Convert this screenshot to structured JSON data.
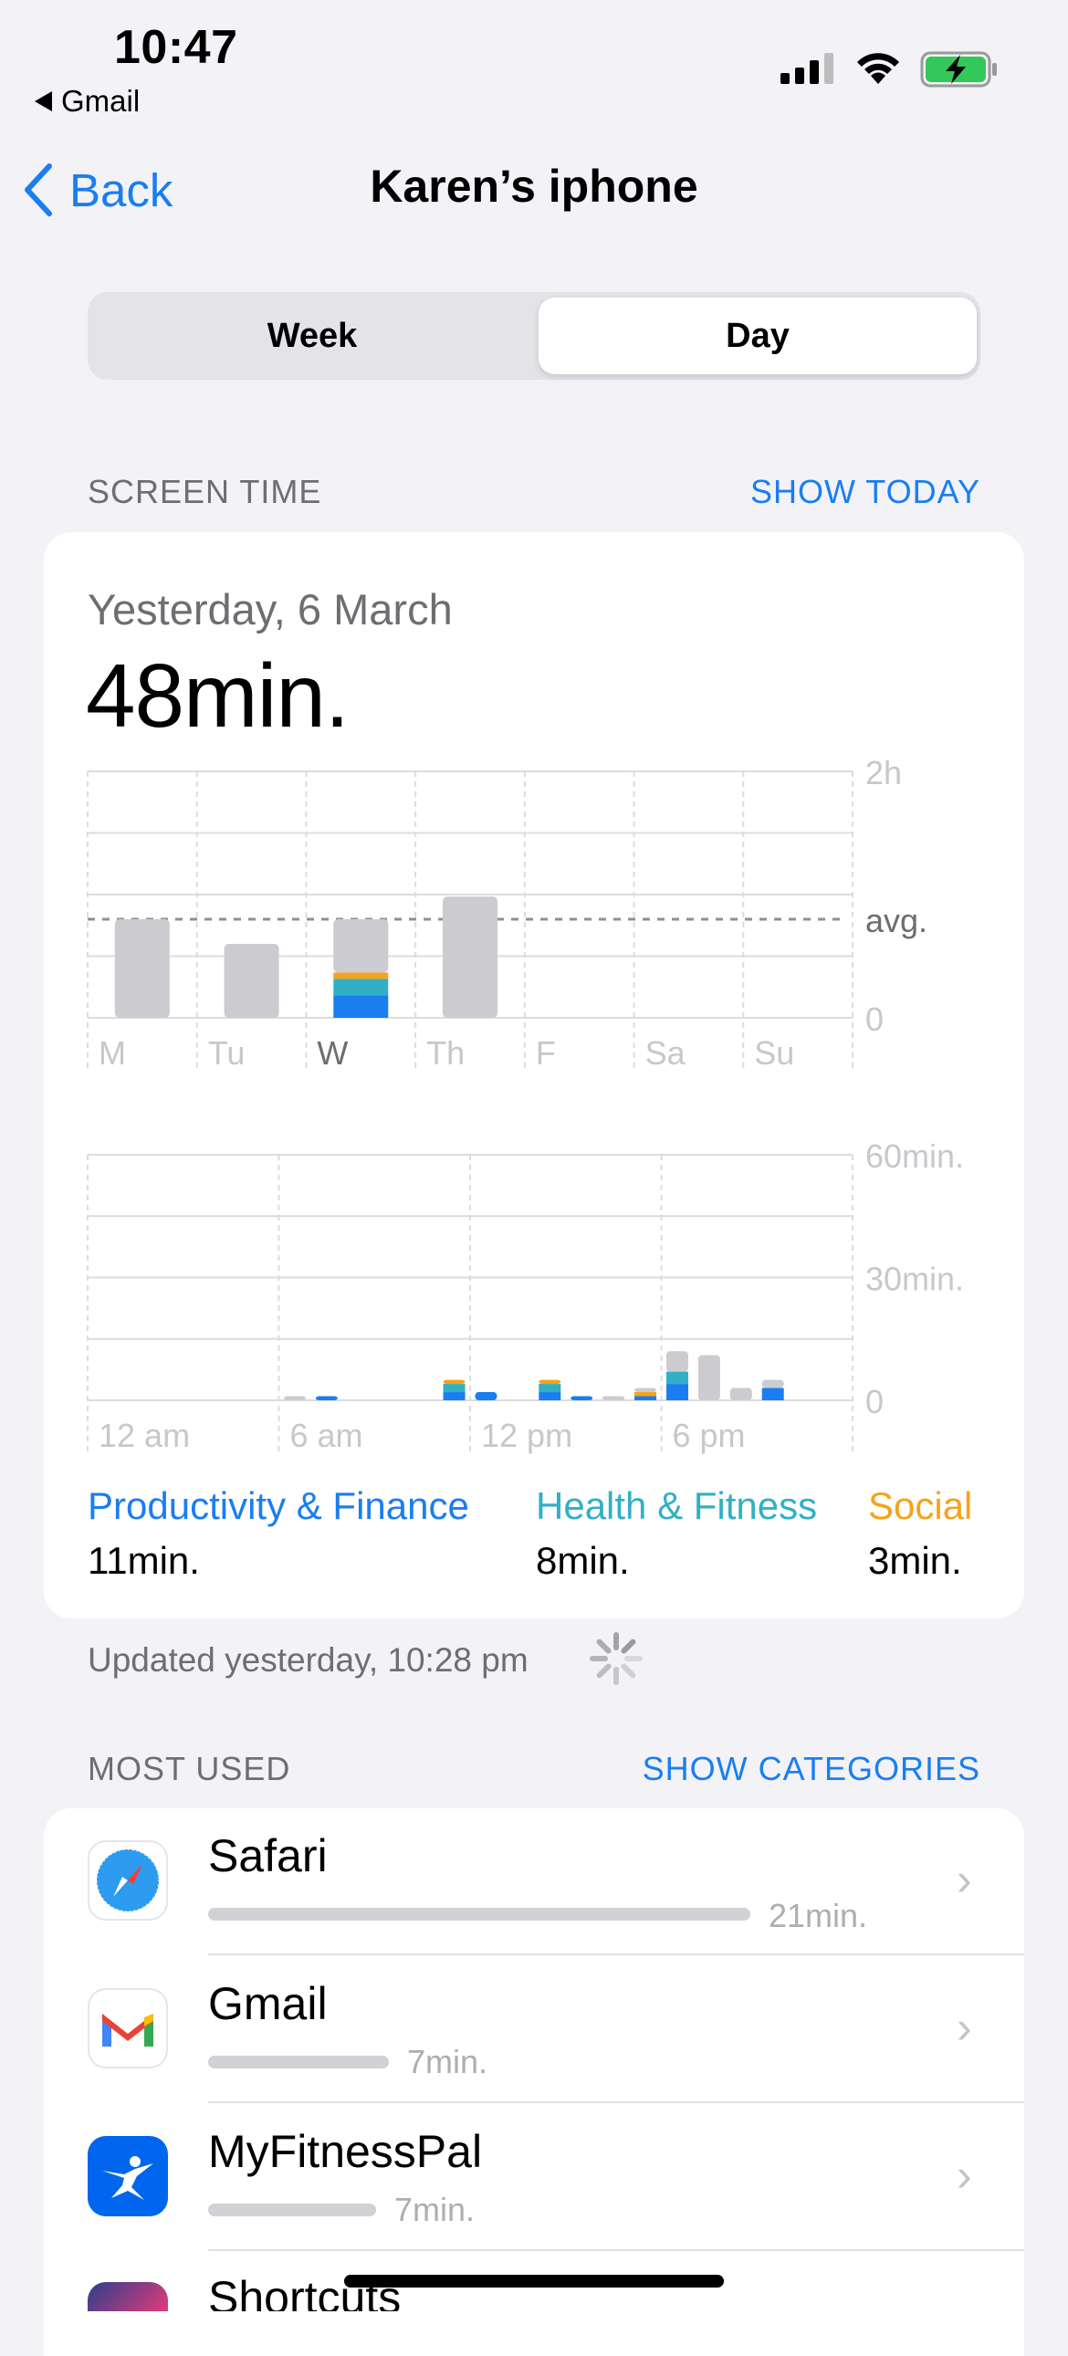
{
  "status_bar": {
    "time": "10:47",
    "back_app": "Gmail"
  },
  "nav": {
    "back_label": "Back",
    "title": "Karen’s iphone"
  },
  "segment": {
    "week": "Week",
    "day": "Day",
    "selected": "Day"
  },
  "screen_time": {
    "header": "SCREEN TIME",
    "action": "SHOW TODAY",
    "date": "Yesterday, 6 March",
    "total": "48min.",
    "updated": "Updated yesterday, 10:28 pm"
  },
  "colors": {
    "accent": "#1A7EF0",
    "productivity": "#1A7EF0",
    "health": "#31B0C5",
    "social": "#F7A21B",
    "other": "#CCCCD0"
  },
  "chart_data": [
    {
      "type": "bar",
      "categories": [
        "M",
        "Tu",
        "W",
        "Th",
        "F",
        "Sa",
        "Su"
      ],
      "ylim": [
        0,
        120
      ],
      "y_ticks": [
        "2h",
        "avg.",
        "0"
      ],
      "average": 48,
      "series": [
        {
          "name": "Productivity & Finance",
          "values": [
            0,
            0,
            11,
            0,
            0,
            0,
            0
          ]
        },
        {
          "name": "Health & Fitness",
          "values": [
            0,
            0,
            8,
            0,
            0,
            0,
            0
          ]
        },
        {
          "name": "Social",
          "values": [
            0,
            0,
            3,
            0,
            0,
            0,
            0
          ]
        },
        {
          "name": "",
          "values": [
            48,
            36,
            26,
            59,
            0,
            0,
            0
          ]
        }
      ]
    },
    {
      "type": "bar",
      "categories": [
        "0",
        "1",
        "2",
        "3",
        "4",
        "5",
        "6",
        "7",
        "8",
        "9",
        "10",
        "11",
        "12",
        "13",
        "14",
        "15",
        "16",
        "17",
        "18",
        "19",
        "20",
        "21",
        "22",
        "23"
      ],
      "x_tick_labels": [
        "12 am",
        "6 am",
        "12 pm",
        "6 pm"
      ],
      "y_ticks": [
        "60min.",
        "30min.",
        "0"
      ],
      "ylim": [
        0,
        60
      ],
      "series": [
        {
          "name": "Productivity & Finance",
          "values": [
            0,
            0,
            0,
            0,
            0,
            0,
            0,
            1,
            0,
            0,
            0,
            2,
            2,
            0,
            2,
            1,
            0,
            1,
            4,
            0,
            0,
            3,
            0,
            0
          ]
        },
        {
          "name": "Health & Fitness",
          "values": [
            0,
            0,
            0,
            0,
            0,
            0,
            0,
            0,
            0,
            0,
            0,
            2,
            0,
            0,
            2,
            0,
            0,
            0,
            3,
            0,
            0,
            0,
            0,
            0
          ]
        },
        {
          "name": "Social",
          "values": [
            0,
            0,
            0,
            0,
            0,
            0,
            0,
            0,
            0,
            0,
            0,
            1,
            0,
            0,
            1,
            0,
            0,
            1,
            0,
            0,
            0,
            0,
            0,
            0
          ]
        },
        {
          "name": "",
          "values": [
            0,
            0,
            0,
            0,
            0,
            0,
            1,
            0,
            0,
            0,
            0,
            0,
            0,
            0,
            0,
            0,
            1,
            1,
            5,
            11,
            3,
            2,
            0,
            0
          ]
        }
      ]
    }
  ],
  "categories": [
    {
      "name": "Productivity & Finance",
      "time": "11min."
    },
    {
      "name": "Health & Fitness",
      "time": "8min."
    },
    {
      "name": "Social",
      "time": "3min."
    }
  ],
  "most_used": {
    "header": "MOST USED",
    "action": "SHOW CATEGORIES",
    "apps": [
      {
        "name": "Safari",
        "time": "21min.",
        "minutes": 21
      },
      {
        "name": "Gmail",
        "time": "7min.",
        "minutes": 7
      },
      {
        "name": "MyFitnessPal",
        "time": "7min.",
        "minutes": 6.5
      },
      {
        "name": "Shortcuts",
        "time": "",
        "minutes": 0
      }
    ]
  }
}
